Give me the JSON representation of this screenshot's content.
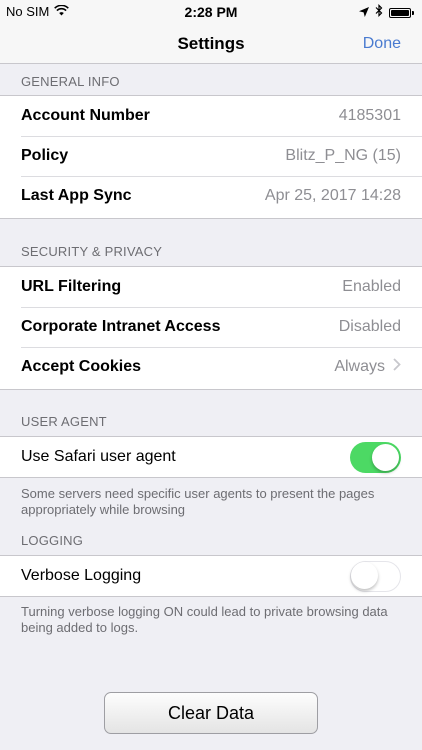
{
  "status_bar": {
    "carrier": "No SIM",
    "time": "2:28 PM"
  },
  "nav": {
    "title": "Settings",
    "done_label": "Done"
  },
  "general_info": {
    "header": "General Info",
    "rows": [
      {
        "label": "Account Number",
        "value": "4185301"
      },
      {
        "label": "Policy",
        "value": "Blitz_P_NG (15)"
      },
      {
        "label": "Last App Sync",
        "value": "Apr 25, 2017 14:28"
      }
    ]
  },
  "security": {
    "header": "Security & Privacy",
    "rows": [
      {
        "label": "URL Filtering",
        "value": "Enabled"
      },
      {
        "label": "Corporate Intranet Access",
        "value": "Disabled"
      },
      {
        "label": "Accept Cookies",
        "value": "Always"
      }
    ]
  },
  "user_agent": {
    "header": "User Agent",
    "label": "Use Safari user agent",
    "enabled": true,
    "note": "Some servers need specific user agents to present the pages appropriately while browsing"
  },
  "logging": {
    "header": "Logging",
    "label": "Verbose Logging",
    "enabled": false,
    "note": "Turning verbose logging ON could lead to private browsing data being added to logs."
  },
  "clear_data_label": "Clear Data",
  "colors": {
    "accent": "#4a7bd0",
    "toggle_on": "#4cd964",
    "background": "#efeff4"
  },
  "icons": [
    "wifi-icon",
    "location-arrow-icon",
    "bluetooth-icon",
    "battery-icon",
    "chevron-right-icon"
  ]
}
